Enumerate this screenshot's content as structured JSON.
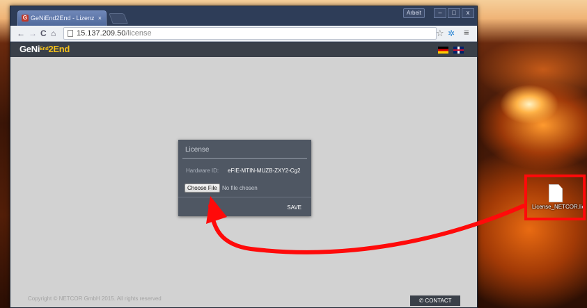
{
  "browser": {
    "tab_title": "GeNiEnd2End - Lizenz",
    "tab_close": "×",
    "favicon": "G",
    "window_user": "Arbeit",
    "minimize": "–",
    "maximize": "□",
    "close": "x",
    "back": "←",
    "forward": "→",
    "reload": "C",
    "home": "⌂",
    "url_host": "15.137.209.50",
    "url_path": "/license",
    "bookmark_icon": "star-icon",
    "menu_icon": "hamburger-menu-icon"
  },
  "site": {
    "logo_main": "GeNi",
    "logo_small": "End",
    "logo_big": "2End",
    "lang_de": "german-flag",
    "lang_en": "uk-flag",
    "copyright": "Copyright © NETCOR GmbH 2015. All rights reserved",
    "contact_label": "CONTACT",
    "contact_icon": "phone-icon"
  },
  "license_dialog": {
    "title": "License",
    "hardware_id_label": "Hardware ID:",
    "hardware_id_value": "eFIE-MTIN-MUZB-ZXY2-Cg2",
    "choose_file_label": "Choose File",
    "file_status": "No file chosen",
    "save_label": "SAVE"
  },
  "desktop": {
    "file_name": "License_NETCOR.lic"
  },
  "annotations": {
    "highlight_color": "#ff0a0a",
    "arrow_color": "#ff0a0a"
  }
}
